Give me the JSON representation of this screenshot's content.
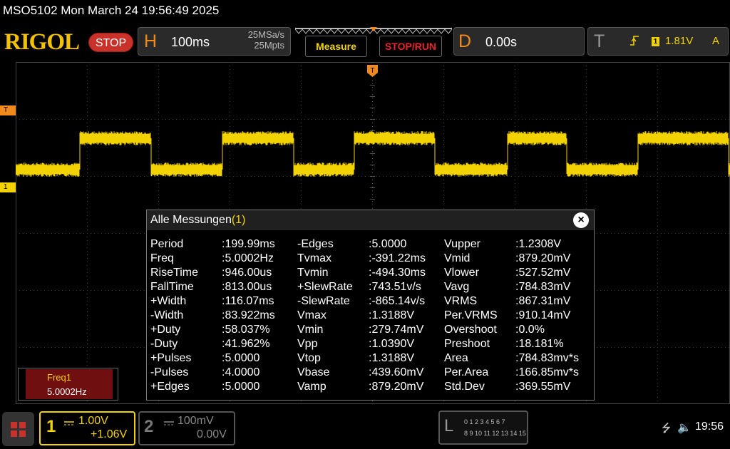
{
  "header": {
    "title": "MSO5102  Mon March 24 19:56:49 2025",
    "logo": "RIGOL",
    "run_state": "STOP"
  },
  "horizontal": {
    "letter": "H",
    "timebase": "100ms",
    "sample_rate": "25MSa/s",
    "memory_depth": "25Mpts"
  },
  "menu": {
    "measure_label": "Measure",
    "stoprun_label": "STOP/RUN"
  },
  "delay": {
    "letter": "D",
    "value": "0.00s"
  },
  "trigger": {
    "letter": "T",
    "source": "1",
    "level": "1.81V",
    "mode": "A"
  },
  "markers": {
    "trigger_level": "T",
    "ch1_ground": "1"
  },
  "panel": {
    "title": "Alle Messungen",
    "count": "(1)",
    "close_symbol": "×",
    "columns": [
      [
        {
          "name": "Period",
          "value": ":199.99ms"
        },
        {
          "name": "Freq",
          "value": ":5.0002Hz"
        },
        {
          "name": "RiseTime",
          "value": ":946.00us"
        },
        {
          "name": "FallTime",
          "value": ":813.00us"
        },
        {
          "name": "+Width",
          "value": ":116.07ms"
        },
        {
          "name": "-Width",
          "value": ":83.922ms"
        },
        {
          "name": "+Duty",
          "value": ":58.037%"
        },
        {
          "name": "-Duty",
          "value": ":41.962%"
        },
        {
          "name": "+Pulses",
          "value": ":5.0000"
        },
        {
          "name": "-Pulses",
          "value": ":4.0000"
        },
        {
          "name": "+Edges",
          "value": ":5.0000"
        }
      ],
      [
        {
          "name": "-Edges",
          "value": ":5.0000"
        },
        {
          "name": "Tvmax",
          "value": ":-391.22ms"
        },
        {
          "name": "Tvmin",
          "value": ":-494.30ms"
        },
        {
          "name": "+SlewRate",
          "value": ":743.51v/s"
        },
        {
          "name": "-SlewRate",
          "value": ":-865.14v/s"
        },
        {
          "name": "Vmax",
          "value": ":1.3188V"
        },
        {
          "name": "Vmin",
          "value": ":279.74mV"
        },
        {
          "name": "Vpp",
          "value": ":1.0390V"
        },
        {
          "name": "Vtop",
          "value": ":1.3188V"
        },
        {
          "name": "Vbase",
          "value": ":439.60mV"
        },
        {
          "name": "Vamp",
          "value": ":879.20mV"
        }
      ],
      [
        {
          "name": "Vupper",
          "value": ":1.2308V"
        },
        {
          "name": "Vmid",
          "value": ":879.20mV"
        },
        {
          "name": "Vlower",
          "value": ":527.52mV"
        },
        {
          "name": "Vavg",
          "value": ":784.83mV"
        },
        {
          "name": "VRMS",
          "value": ":867.31mV"
        },
        {
          "name": "Per.VRMS",
          "value": ":910.14mV"
        },
        {
          "name": "Overshoot",
          "value": ":0.0%"
        },
        {
          "name": "Preshoot",
          "value": ":18.181%"
        },
        {
          "name": "Area",
          "value": ":784.83mv*s"
        },
        {
          "name": "Per.Area",
          "value": ":166.85mv*s"
        },
        {
          "name": "Std.Dev",
          "value": ":369.55mV"
        }
      ]
    ]
  },
  "freq_box": {
    "label": "Freq1",
    "value": "5.0002Hz"
  },
  "ch1": {
    "number": "1",
    "scale": "1.00V",
    "offset": "+1.06V"
  },
  "ch2": {
    "number": "2",
    "scale": "100mV",
    "offset": "0.00V"
  },
  "logic": {
    "letter": "L",
    "row1": "0 1 2 3   4 5 6 7",
    "row2": "8  9 10 11  12 13 14 15"
  },
  "status": {
    "usb_icon": "⭍",
    "speaker_icon": "🔈",
    "time": "19:56"
  },
  "colors": {
    "ch1": "#f2d200",
    "trigger": "#f08a1d",
    "stop": "#c8322a",
    "panel_count": "#f2d200"
  }
}
